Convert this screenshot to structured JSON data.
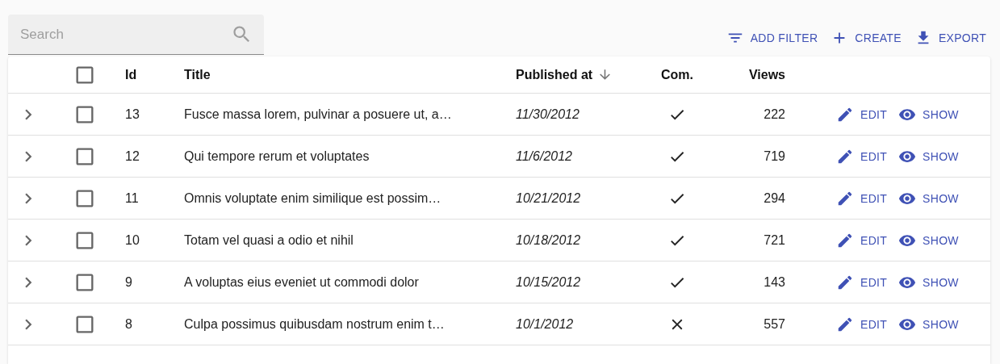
{
  "search": {
    "placeholder": "Search"
  },
  "toolbar": [
    {
      "kind": "filter",
      "label": "ADD FILTER"
    },
    {
      "kind": "create",
      "label": "CREATE"
    },
    {
      "kind": "export",
      "label": "EXPORT"
    }
  ],
  "table": {
    "select_all": {
      "checked": false
    },
    "columns": [
      {
        "label": "Id",
        "sorted": false
      },
      {
        "label": "Title",
        "sorted": false
      },
      {
        "label": "Published at",
        "sorted": true
      },
      {
        "label": "Com.",
        "sorted": false
      },
      {
        "label": "Views",
        "sorted": false
      }
    ],
    "rows": [
      {
        "expanded": false,
        "checked": false,
        "id": "13",
        "title": "Fusce massa lorem, pulvinar a posuere ut, a…",
        "published_at": "11/30/2012",
        "commentable": true,
        "views": "222",
        "actions": [
          "EDIT",
          "SHOW"
        ]
      },
      {
        "expanded": false,
        "checked": false,
        "id": "12",
        "title": "Qui tempore rerum et voluptates",
        "published_at": "11/6/2012",
        "commentable": true,
        "views": "719",
        "actions": [
          "EDIT",
          "SHOW"
        ]
      },
      {
        "expanded": false,
        "checked": false,
        "id": "11",
        "title": "Omnis voluptate enim similique est possim…",
        "published_at": "10/21/2012",
        "commentable": true,
        "views": "294",
        "actions": [
          "EDIT",
          "SHOW"
        ]
      },
      {
        "expanded": false,
        "checked": false,
        "id": "10",
        "title": "Totam vel quasi a odio et nihil",
        "published_at": "10/18/2012",
        "commentable": true,
        "views": "721",
        "actions": [
          "EDIT",
          "SHOW"
        ]
      },
      {
        "expanded": false,
        "checked": false,
        "id": "9",
        "title": "A voluptas eius eveniet ut commodi dolor",
        "published_at": "10/15/2012",
        "commentable": true,
        "views": "143",
        "actions": [
          "EDIT",
          "SHOW"
        ]
      },
      {
        "expanded": false,
        "checked": false,
        "id": "8",
        "title": "Culpa possimus quibusdam nostrum enim t…",
        "published_at": "10/1/2012",
        "commentable": false,
        "views": "557",
        "actions": [
          "EDIT",
          "SHOW"
        ]
      }
    ]
  }
}
